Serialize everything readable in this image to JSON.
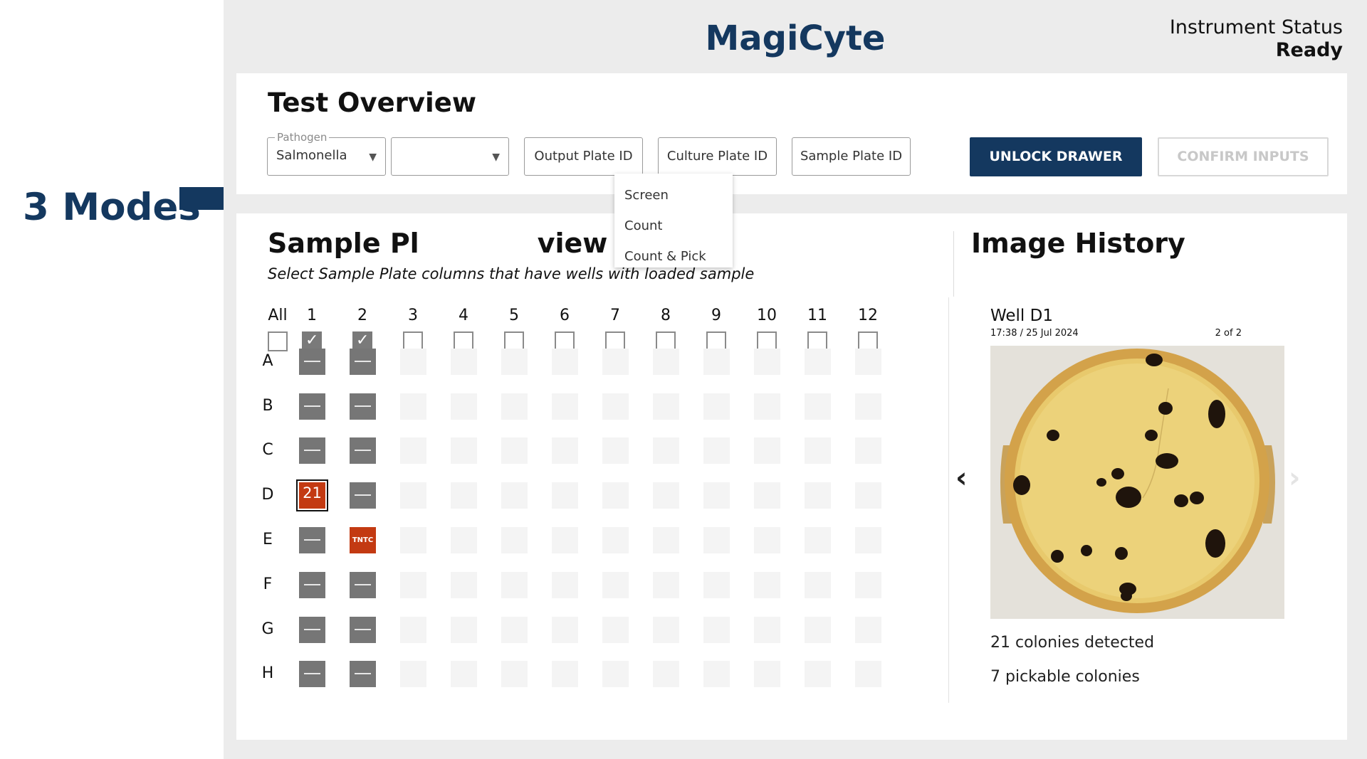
{
  "annotation": {
    "label": "3 Modes"
  },
  "header": {
    "app_title": "MagiCyte",
    "status_label": "Instrument Status",
    "status_value": "Ready"
  },
  "test_overview": {
    "title": "Test Overview",
    "pathogen": {
      "legend": "Pathogen",
      "value": "Salmonella"
    },
    "mode_select": {
      "value": "",
      "options": [
        "Screen",
        "Count",
        "Count & Pick"
      ]
    },
    "output_plate_placeholder": "Output Plate ID",
    "culture_plate_placeholder": "Culture Plate ID",
    "sample_plate_placeholder": "Sample Plate ID",
    "unlock_label": "UNLOCK DRAWER",
    "confirm_label": "CONFIRM INPUTS"
  },
  "sample_plate": {
    "title_left": "Sample Pl",
    "title_right": "view",
    "subtitle": "Select Sample Plate columns that have wells with loaded sample",
    "all_label": "All",
    "columns": [
      "1",
      "2",
      "3",
      "4",
      "5",
      "6",
      "7",
      "8",
      "9",
      "10",
      "11",
      "12"
    ],
    "checked_columns": [
      "1",
      "2"
    ],
    "rows": [
      "A",
      "B",
      "C",
      "D",
      "E",
      "F",
      "G",
      "H"
    ],
    "wells": {
      "1": [
        "dash",
        "dash",
        "dash",
        "21",
        "dash",
        "dash",
        "dash",
        "dash"
      ],
      "2": [
        "dash",
        "dash",
        "dash",
        "dash",
        "TNTC",
        "dash",
        "dash",
        "dash"
      ]
    }
  },
  "image_history": {
    "title": "Image History",
    "well_title": "Well D1",
    "timestamp": "17:38 / 25 Jul 2024",
    "index": "2 of 2",
    "colonies_detected": "21 colonies detected",
    "pickable_colonies": "7 pickable colonies"
  }
}
